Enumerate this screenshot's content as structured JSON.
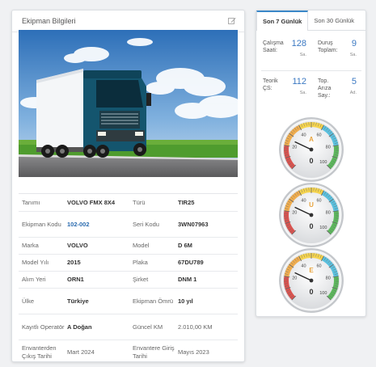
{
  "card": {
    "title": "Ekipman Bilgileri"
  },
  "details": [
    {
      "l1": "Tanımı",
      "v1": "VOLVO FMX 8X4",
      "l2": "Türü",
      "v2": "TIR25"
    },
    {
      "l1": "Ekipman Kodu",
      "v1": "102-002",
      "l2": "Seri Kodu",
      "v2": "3WN07963"
    },
    {
      "l1": "Marka",
      "v1": "VOLVO",
      "l2": "Model",
      "v2": "D 6M"
    },
    {
      "l1": "Model Yılı",
      "v1": "2015",
      "l2": "Plaka",
      "v2": "67DU789"
    },
    {
      "l1": "Alım Yeri",
      "v1": "ORN1",
      "l2": "Şirket",
      "v2": "DNM 1"
    },
    {
      "l1": "Ülke",
      "v1": "Türkiye",
      "l2": "Ekipman Ömrü",
      "v2": "10 yıl"
    },
    {
      "l1": "Kayıtlı Operatör",
      "v1": "A Doğan",
      "l2": "Güncel KM",
      "v2": "2.010,00 KM"
    },
    {
      "l1": "Envanterden Çıkış Tarihi",
      "v1": "Mart 2024",
      "l2": "Envantere Giriş Tarihi",
      "v2": "Mayıs 2023"
    }
  ],
  "tabs": [
    "Son 7 Günlük",
    "Son 30 Günlük"
  ],
  "stats": {
    "calisma": {
      "label": "Çalışma Saati:",
      "value": "128",
      "unit": "Sa."
    },
    "durus": {
      "label": "Duruş Toplam:",
      "value": "9",
      "unit": "Sa."
    },
    "teorik": {
      "label": "Teorik ÇS:",
      "value": "112",
      "unit": "Sa."
    },
    "ariza": {
      "label": "Top. Arıza Say.:",
      "value": "5",
      "unit": "Ad."
    }
  },
  "gauges": [
    {
      "letter": "A",
      "value": "0",
      "reading": 0
    },
    {
      "letter": "U",
      "value": "0",
      "reading": 0
    },
    {
      "letter": "E",
      "value": "0",
      "reading": 0
    }
  ],
  "gauge_ticks": [
    "20",
    "40",
    "60",
    "80",
    "100"
  ],
  "colors": {
    "accent": "#3a78c2",
    "gauge_letter": "#e8a33d"
  }
}
